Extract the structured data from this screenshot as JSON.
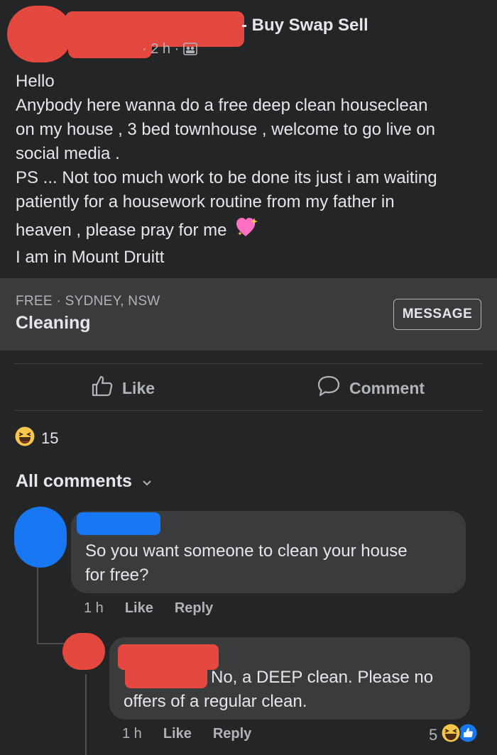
{
  "post": {
    "group_suffix": "- Buy Swap Sell",
    "time": "2 h",
    "audience_icon": "group-icon",
    "lines": [
      "Hello",
      "Anybody here wanna do a free deep clean houseclean",
      "on my house , 3 bed townhouse , welcome to go live on",
      "social media .",
      "PS ... Not too much work to be done its just i am waiting",
      "patiently for a housework routine from my father in",
      "heaven , please pray for me",
      "I am in Mount Druitt"
    ]
  },
  "listing": {
    "subtitle": "FREE · SYDNEY, NSW",
    "title": "Cleaning",
    "message_label": "MESSAGE"
  },
  "actions": {
    "like_label": "Like",
    "comment_label": "Comment"
  },
  "reactions": {
    "count": "15",
    "icon": "haha-emoji-icon"
  },
  "comments_header": {
    "label": "All comments"
  },
  "comments": [
    {
      "text_lines": [
        "So you want someone to clean your house",
        "for free?"
      ],
      "time": "1 h",
      "like_label": "Like",
      "reply_label": "Reply"
    },
    {
      "text_lines": [
        "No, a DEEP clean. Please no",
        "offers of a regular clean."
      ],
      "time": "1 h",
      "like_label": "Like",
      "reply_label": "Reply",
      "reaction_count": "5"
    }
  ],
  "colors": {
    "background": "#242526",
    "card": "#3a3b3c",
    "accent": "#1877f2",
    "redaction": "#e5483f"
  }
}
